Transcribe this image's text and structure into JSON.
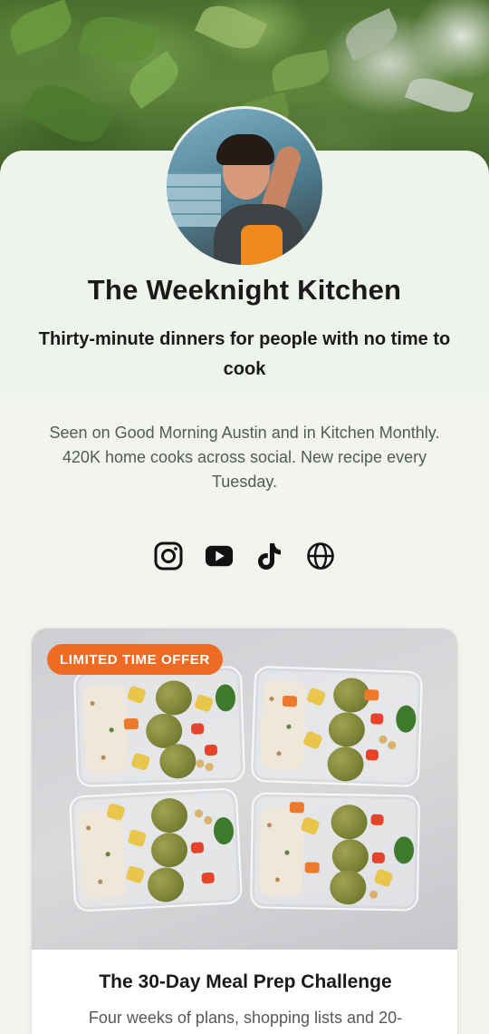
{
  "profile": {
    "title": "The Weeknight Kitchen",
    "tagline": "Thirty-minute dinners for people with no time to cook",
    "bio": "Seen on Good Morning Austin and in Kitchen Monthly. 420K home cooks across social. New recipe every Tuesday."
  },
  "socials": [
    {
      "icon": "instagram-icon"
    },
    {
      "icon": "youtube-icon"
    },
    {
      "icon": "tiktok-icon"
    },
    {
      "icon": "globe-icon"
    }
  ],
  "offer": {
    "badge": "LIMITED TIME OFFER",
    "title": "The 30-Day Meal Prep Challenge",
    "description": "Four weeks of plans, shopping lists and 20-"
  },
  "colors": {
    "accent": "#ef6b25",
    "background": "#f2f5ef",
    "text": "#1a1a1a",
    "muted_text": "#555a55"
  }
}
